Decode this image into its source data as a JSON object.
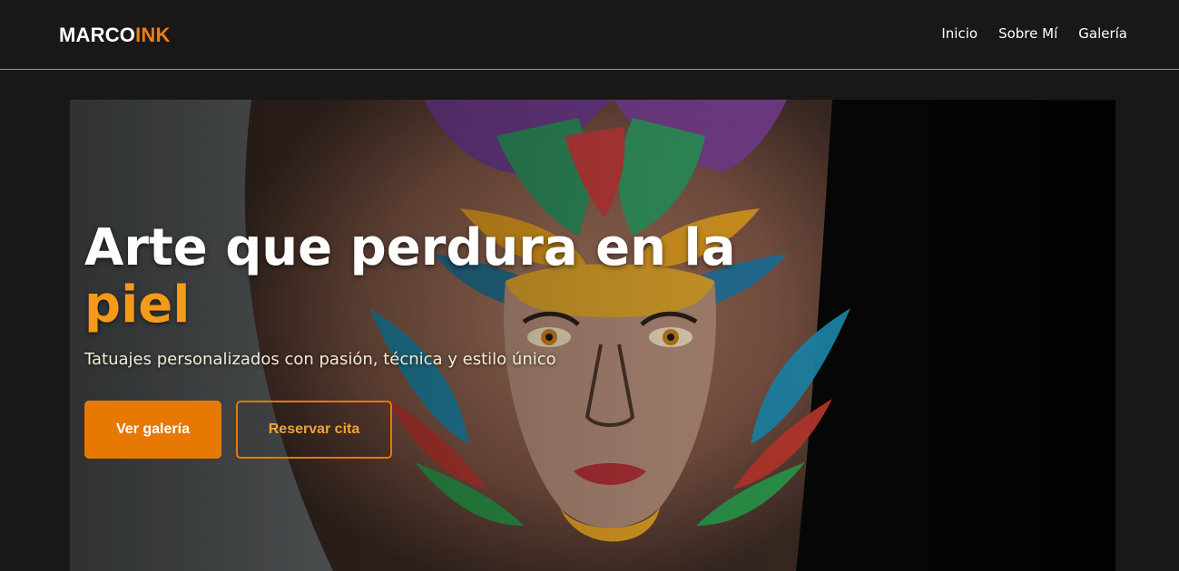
{
  "brand": {
    "part1": "MARCO",
    "part2": "INK"
  },
  "nav": {
    "items": [
      "Inicio",
      "Sobre Mí",
      "Galería"
    ]
  },
  "hero": {
    "title_line1": "Arte que perdura en la",
    "title_line2": "piel",
    "subtitle": "Tatuajes personalizados con pasión, técnica y estilo único",
    "primary_button": "Ver galería",
    "secondary_button": "Reservar cita",
    "background_image": "tattoo-arm-photo"
  },
  "colors": {
    "accent": "#e77903",
    "accent_text": "#f59a18",
    "background": "#1a1817"
  }
}
